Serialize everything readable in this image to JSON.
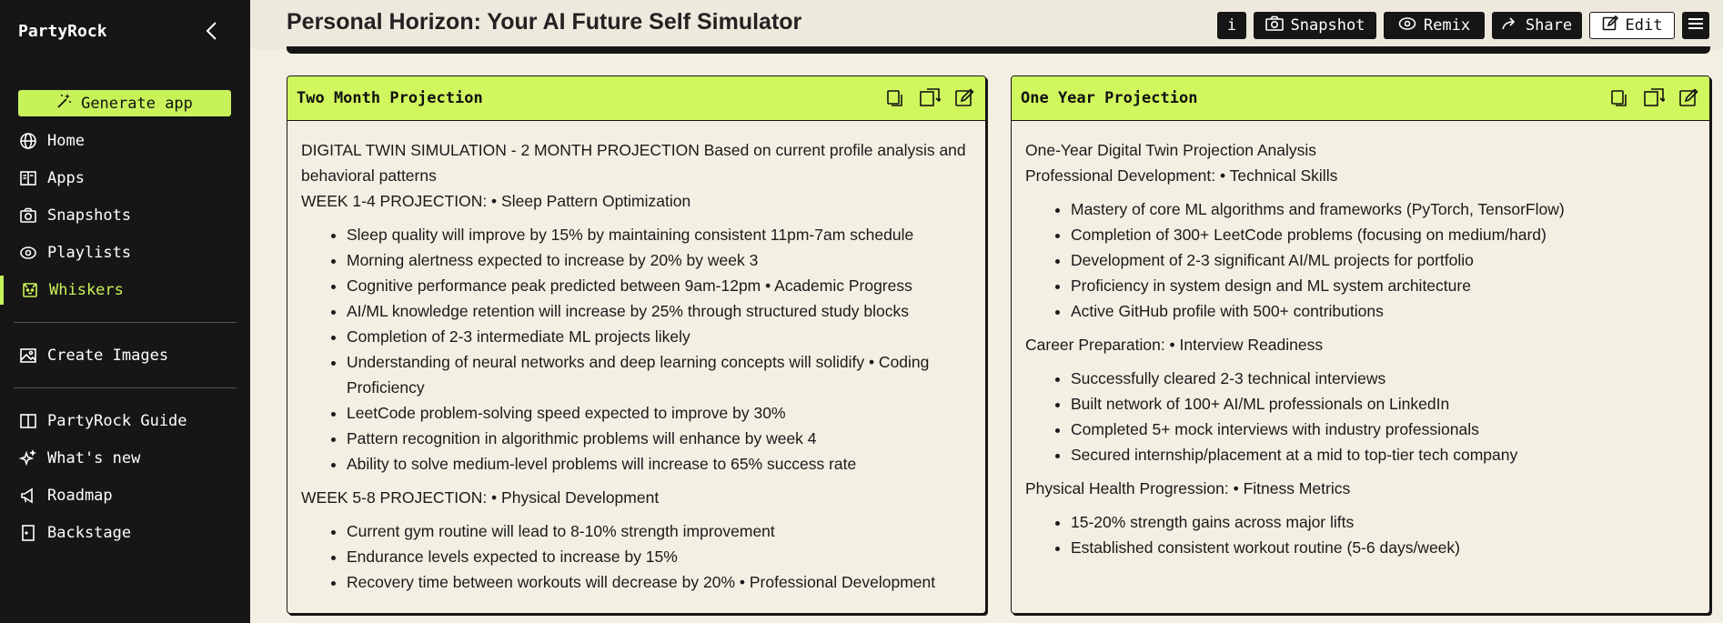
{
  "sidebar": {
    "brand": "PartyRock",
    "generate_label": "Generate app",
    "nav": [
      {
        "label": "Home",
        "icon": "globe-icon"
      },
      {
        "label": "Apps",
        "icon": "book-icon"
      },
      {
        "label": "Snapshots",
        "icon": "camera-icon"
      },
      {
        "label": "Playlists",
        "icon": "playlist-icon"
      },
      {
        "label": "Whiskers",
        "icon": "cat-icon",
        "active": true
      }
    ],
    "nav2": [
      {
        "label": "Create Images",
        "icon": "image-icon"
      }
    ],
    "nav3": [
      {
        "label": "PartyRock Guide",
        "icon": "guide-book-icon"
      },
      {
        "label": "What's new",
        "icon": "sparkles-icon"
      },
      {
        "label": "Roadmap",
        "icon": "megaphone-icon"
      },
      {
        "label": "Backstage",
        "icon": "door-icon"
      }
    ]
  },
  "header": {
    "title": "Personal Horizon: Your AI Future Self Simulator",
    "info_label": "i",
    "snapshot_label": "Snapshot",
    "remix_label": "Remix",
    "share_label": "Share",
    "edit_label": "Edit"
  },
  "cards": {
    "left": {
      "title": "Two Month Projection",
      "intro": "DIGITAL TWIN SIMULATION - 2 MONTH PROJECTION Based on current profile analysis and behavioral patterns",
      "sec1": "WEEK 1-4 PROJECTION: • Sleep Pattern Optimization",
      "list1": [
        "Sleep quality will improve by 15% by maintaining consistent 11pm-7am schedule",
        "Morning alertness expected to increase by 20% by week 3",
        "Cognitive performance peak predicted between 9am-12pm • Academic Progress",
        "AI/ML knowledge retention will increase by 25% through structured study blocks",
        "Completion of 2-3 intermediate ML projects likely",
        "Understanding of neural networks and deep learning concepts will solidify • Coding Proficiency",
        "LeetCode problem-solving speed expected to improve by 30%",
        "Pattern recognition in algorithmic problems will enhance by week 4",
        "Ability to solve medium-level problems will increase to 65% success rate"
      ],
      "sec2": "WEEK 5-8 PROJECTION: • Physical Development",
      "list2": [
        "Current gym routine will lead to 8-10% strength improvement",
        "Endurance levels expected to increase by 15%",
        "Recovery time between workouts will decrease by 20% • Professional Development"
      ]
    },
    "right": {
      "title": "One Year Projection",
      "line1": "One-Year Digital Twin Projection Analysis",
      "line2": "Professional Development: • Technical Skills",
      "list1": [
        "Mastery of core ML algorithms and frameworks (PyTorch, TensorFlow)",
        "Completion of 300+ LeetCode problems (focusing on medium/hard)",
        "Development of 2-3 significant AI/ML projects for portfolio",
        "Proficiency in system design and ML system architecture",
        "Active GitHub profile with 500+ contributions"
      ],
      "sec2": "Career Preparation: • Interview Readiness",
      "list2": [
        "Successfully cleared 2-3 technical interviews",
        "Built network of 100+ AI/ML professionals on LinkedIn",
        "Completed 5+ mock interviews with industry professionals",
        "Secured internship/placement at a mid to top-tier tech company"
      ],
      "sec3": "Physical Health Progression: • Fitness Metrics",
      "list3": [
        "15-20% strength gains across major lifts",
        "Established consistent workout routine (5-6 days/week)"
      ]
    }
  },
  "colors": {
    "accent": "#c8f25a",
    "card_header": "#d1f75e",
    "sidebar_bg": "#161616",
    "page_bg": "#f3efe3"
  }
}
